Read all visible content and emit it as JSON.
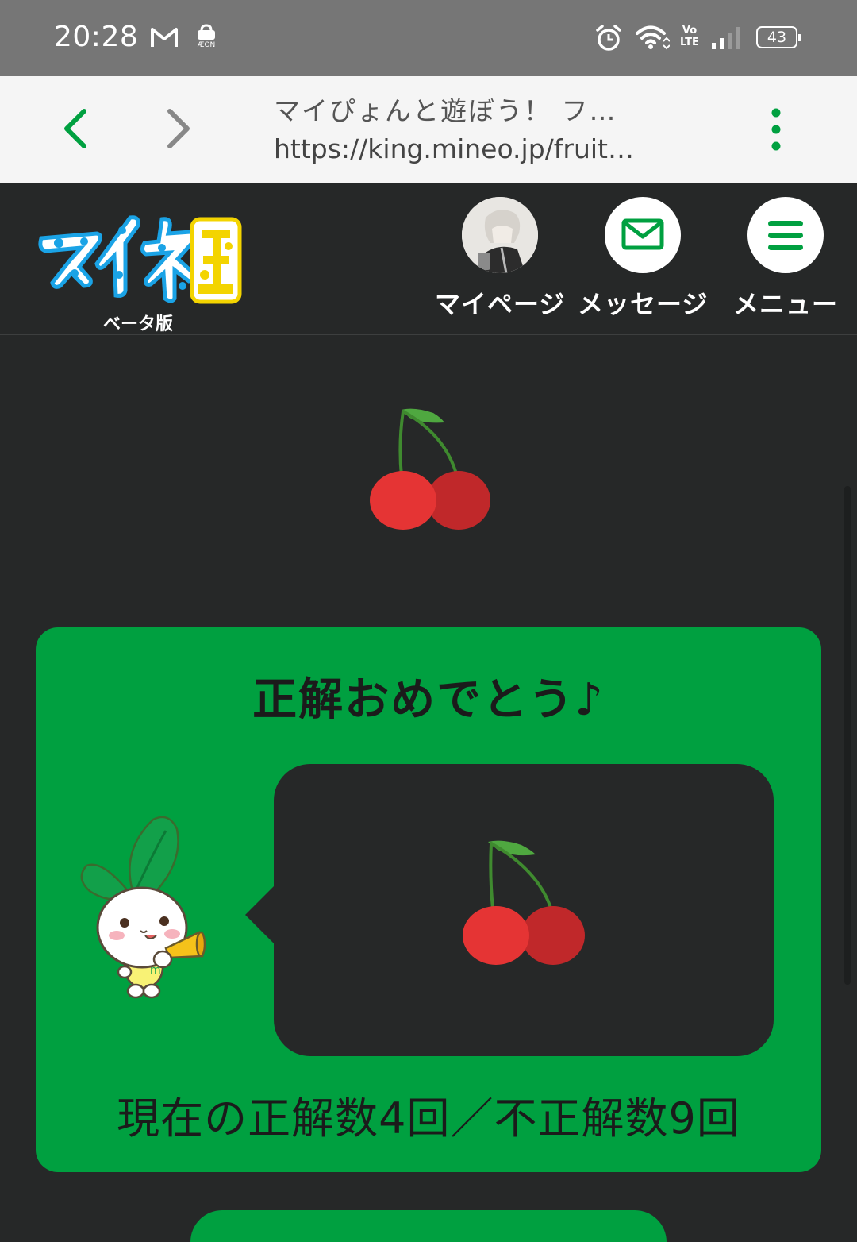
{
  "status_bar": {
    "time": "20:28",
    "aeon_label": "ÆON",
    "volte_label": "Vo LTE",
    "battery_level": "43",
    "notification_icons": [
      "gmail-icon",
      "aeon-icon"
    ],
    "system_icons": [
      "alarm-icon",
      "wifi-icon",
      "volte-icon",
      "signal-icon",
      "battery-icon"
    ]
  },
  "browser": {
    "page_title": "マイぴょんと遊ぼう！ フ…",
    "url": "https://king.mineo.jp/fruit…",
    "accent_color": "#00a040"
  },
  "header": {
    "logo_text": "マイネ王",
    "logo_sub": "ベータ版",
    "nav": [
      {
        "label": "マイページ",
        "icon": "avatar"
      },
      {
        "label": "メッセージ",
        "icon": "envelope-icon"
      },
      {
        "label": "メニュー",
        "icon": "hamburger-icon"
      }
    ]
  },
  "game": {
    "selected_fruit": "cherry-icon",
    "result_title": "正解おめでとう♪",
    "answer_fruit": "cherry-icon",
    "score_text": "現在の正解数4回／不正解数9回",
    "correct_count": 4,
    "incorrect_count": 9,
    "card_color": "#00a040"
  }
}
